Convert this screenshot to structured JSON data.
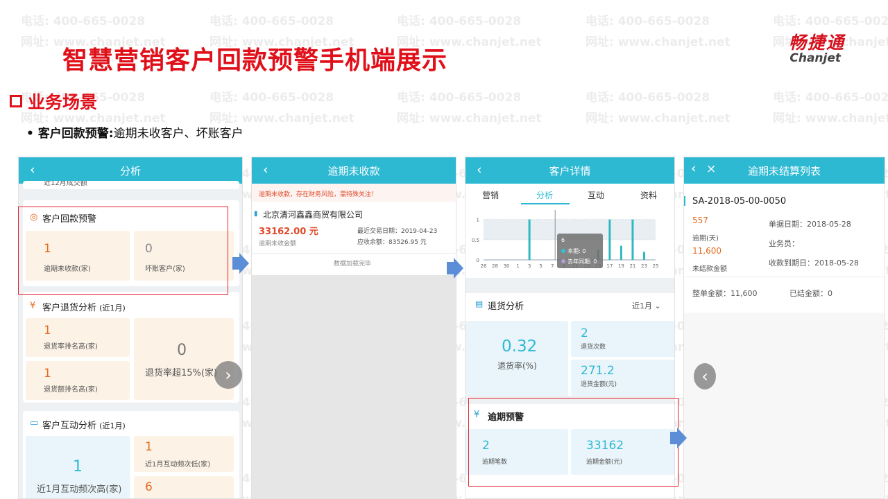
{
  "watermark": {
    "phone": "电话: 400-665-0028",
    "web": "网址: www.chanjet.net"
  },
  "slide": {
    "title": "智慧营销客户回款预警手机端展示",
    "logo_cn": "畅捷通",
    "logo_en": "Chanjet",
    "section": "业务场景",
    "bullet_bold": "客户回款预警:",
    "bullet_text": "逾期未收客户、坏账客户"
  },
  "phone1": {
    "title": "分析",
    "partial_top": "近12月成交额",
    "card1": {
      "title": "客户回款预警",
      "v1": "1",
      "l1": "逾期未收款(家)",
      "v2": "0",
      "l2": "坏账客户(家)"
    },
    "card2": {
      "title": "客户退货分析",
      "period": "(近1月)",
      "v1": "1",
      "l1": "退货率排名高(家)",
      "v2": "1",
      "l2": "退货额排名高(家)",
      "v3": "0",
      "l3": "退货率超15%(家)"
    },
    "card3": {
      "title": "客户互动分析",
      "period": "(近1月)",
      "v1": "1",
      "l1": "近1月互动频次高(家)",
      "v2": "1",
      "l2": "近1月互动频次低(家)",
      "v3": "6"
    }
  },
  "phone2": {
    "title": "逾期未收款",
    "warning": "逾期未收款，存在财务风险，需特殊关注！",
    "company": "北京清河鑫鑫商贸有限公司",
    "amount": "33162.00 元",
    "amount_label": "逾期未收金额",
    "last_trade": "最近交易日期：2019-04-23",
    "receivable": "应收余额：83526.95 元",
    "footer": "数据加载完毕"
  },
  "phone3": {
    "title": "客户详情",
    "tabs": [
      "营销",
      "分析",
      "互动",
      "资料"
    ],
    "returns": {
      "title": "退货分析",
      "period": "近1月",
      "rate": "0.32",
      "rate_label": "退货率(%)",
      "count": "2",
      "count_label": "退货次数",
      "amount": "271.2",
      "amount_label": "退货金额(元)"
    },
    "overdue": {
      "title": "逾期预警",
      "count": "2",
      "count_label": "逾期笔数",
      "amount": "33162",
      "amount_label": "逾期金额(元)"
    }
  },
  "phone4": {
    "title": "逾期未结算列表",
    "doc_no": "SA-2018-05-00-0050",
    "days": "557",
    "days_label": "逾期(天)",
    "doc_date": "单据日期：2018-05-28",
    "salesman": "业务员：",
    "unpaid": "11,600",
    "unpaid_label": "未结款金额",
    "due_date": "收款到期日：2018-05-28",
    "total": "整单金额：11,600",
    "paid": "已结金额：0"
  },
  "chart_data": {
    "type": "bar",
    "x": [
      "26",
      "28",
      "30",
      "1",
      "3",
      "5",
      "7",
      "9",
      "11",
      "13",
      "15",
      "17",
      "19",
      "21",
      "23",
      "25"
    ],
    "yticks": [
      "1",
      "0.5",
      "0"
    ],
    "ylim": [
      0,
      1.2
    ],
    "bars": [
      {
        "x": "3",
        "value": 1
      },
      {
        "x": "15",
        "value": 0.25
      },
      {
        "x": "17",
        "value": 1
      },
      {
        "x": "19",
        "value": 0.35
      },
      {
        "x": "21",
        "value": 1
      },
      {
        "x": "23",
        "value": 0.2
      }
    ],
    "tooltip": {
      "title": "6",
      "series1": "本期: 0",
      "series2": "去年同期: 0"
    },
    "colors": {
      "bar": "#2eb9c2",
      "band": "#e9eef2"
    }
  }
}
